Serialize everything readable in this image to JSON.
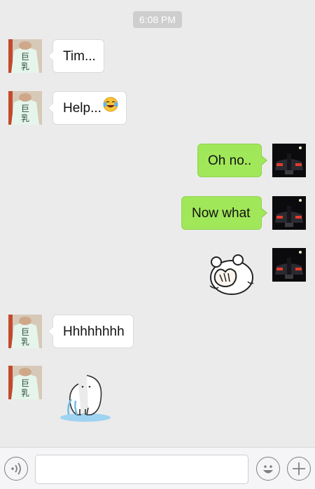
{
  "chat": {
    "timestamp": "6:08 PM",
    "messages": [
      {
        "side": "in",
        "type": "text",
        "text": "Tim..."
      },
      {
        "side": "in",
        "type": "text",
        "text": "Help...",
        "emoji": "tears-of-joy-emoji"
      },
      {
        "side": "out",
        "type": "text",
        "text": "Oh no.."
      },
      {
        "side": "out",
        "type": "text",
        "text": "Now what"
      },
      {
        "side": "out",
        "type": "sticker",
        "sticker": "facepalm-bear-sticker"
      },
      {
        "side": "in",
        "type": "text",
        "text": "Hhhhhhhh"
      },
      {
        "side": "in",
        "type": "sticker",
        "sticker": "crying-puddle-sticker"
      }
    ],
    "avatars": {
      "contact": {
        "glyphs": [
          "巨",
          "乳"
        ],
        "shirt_color": "#e6f5ec"
      },
      "self": {
        "icon": "car-night-avatar"
      }
    }
  },
  "input_bar": {
    "voice_icon": "voice-icon",
    "message_value": "",
    "emoji_icon": "emoji-icon",
    "add_icon": "plus-icon"
  },
  "colors": {
    "background": "#ebebeb",
    "outgoing_bubble": "#a0e75a",
    "incoming_bubble": "#ffffff",
    "timestamp_pill": "#cecece"
  }
}
